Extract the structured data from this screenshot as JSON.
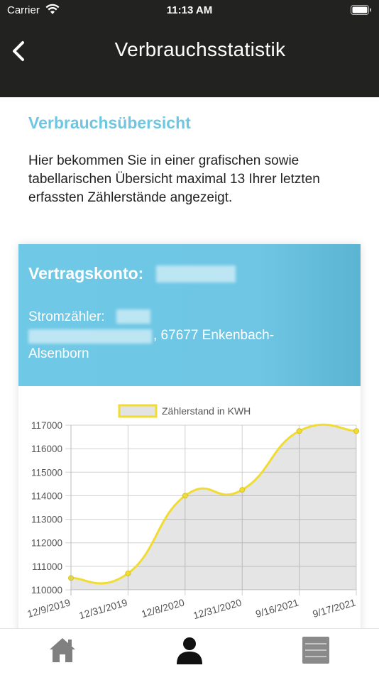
{
  "status_bar": {
    "carrier": "Carrier",
    "time": "11:13 AM"
  },
  "nav": {
    "title": "Verbrauchsstatistik"
  },
  "intro": {
    "heading": "Verbrauchsübersicht",
    "text": "Hier bekommen Sie in einer grafischen sowie tabellarischen Übersicht maximal 13 Ihrer letzten erfassten Zählerstände angezeigt."
  },
  "account": {
    "label": "Vertragskonto:",
    "meter_label": "Stromzähler:",
    "address_line1": ", 67677 Enkenbach-",
    "address_line2": "Alsenborn"
  },
  "colors": {
    "accent": "#6fc6e2",
    "nav_bg": "#222221",
    "series": "#f0dc33"
  },
  "chart_data": {
    "type": "area",
    "categories": [
      "12/9/2019",
      "12/31/2019",
      "12/8/2020",
      "12/31/2020",
      "9/16/2021",
      "9/17/2021"
    ],
    "series": [
      {
        "name": "Zählerstand in KWH",
        "values": [
          110500,
          110700,
          114000,
          114250,
          116750,
          116750
        ]
      }
    ],
    "ylim": [
      110000,
      117000
    ],
    "yticks": [
      "117000",
      "116000",
      "115000",
      "114000",
      "113000",
      "112000",
      "111000",
      "110000"
    ],
    "grid": true,
    "legend": "top"
  },
  "tabs": [
    {
      "icon": "home-icon"
    },
    {
      "icon": "user-icon"
    },
    {
      "icon": "menu-icon"
    }
  ]
}
